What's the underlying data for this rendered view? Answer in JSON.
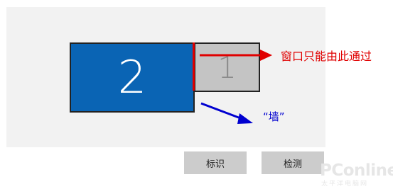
{
  "monitors": {
    "primary_number": "2",
    "secondary_number": "1"
  },
  "annotations": {
    "red_note": "窗口只能由此通过",
    "blue_note": "“墙”"
  },
  "buttons": {
    "identify_label": "标识",
    "detect_label": "检测"
  },
  "watermark": {
    "brand": "PConline",
    "subtitle": "太平洋电脑网"
  },
  "colors": {
    "primary_monitor": "#0a64b4",
    "secondary_monitor": "#c4c4c4",
    "red_annotation": "#e00000",
    "blue_annotation": "#0000d0",
    "panel_background": "#f2f2f2",
    "button_background": "#cccccc"
  },
  "icons": {
    "red_arrow": "arrow-right-icon",
    "blue_arrow": "arrow-down-right-icon"
  }
}
